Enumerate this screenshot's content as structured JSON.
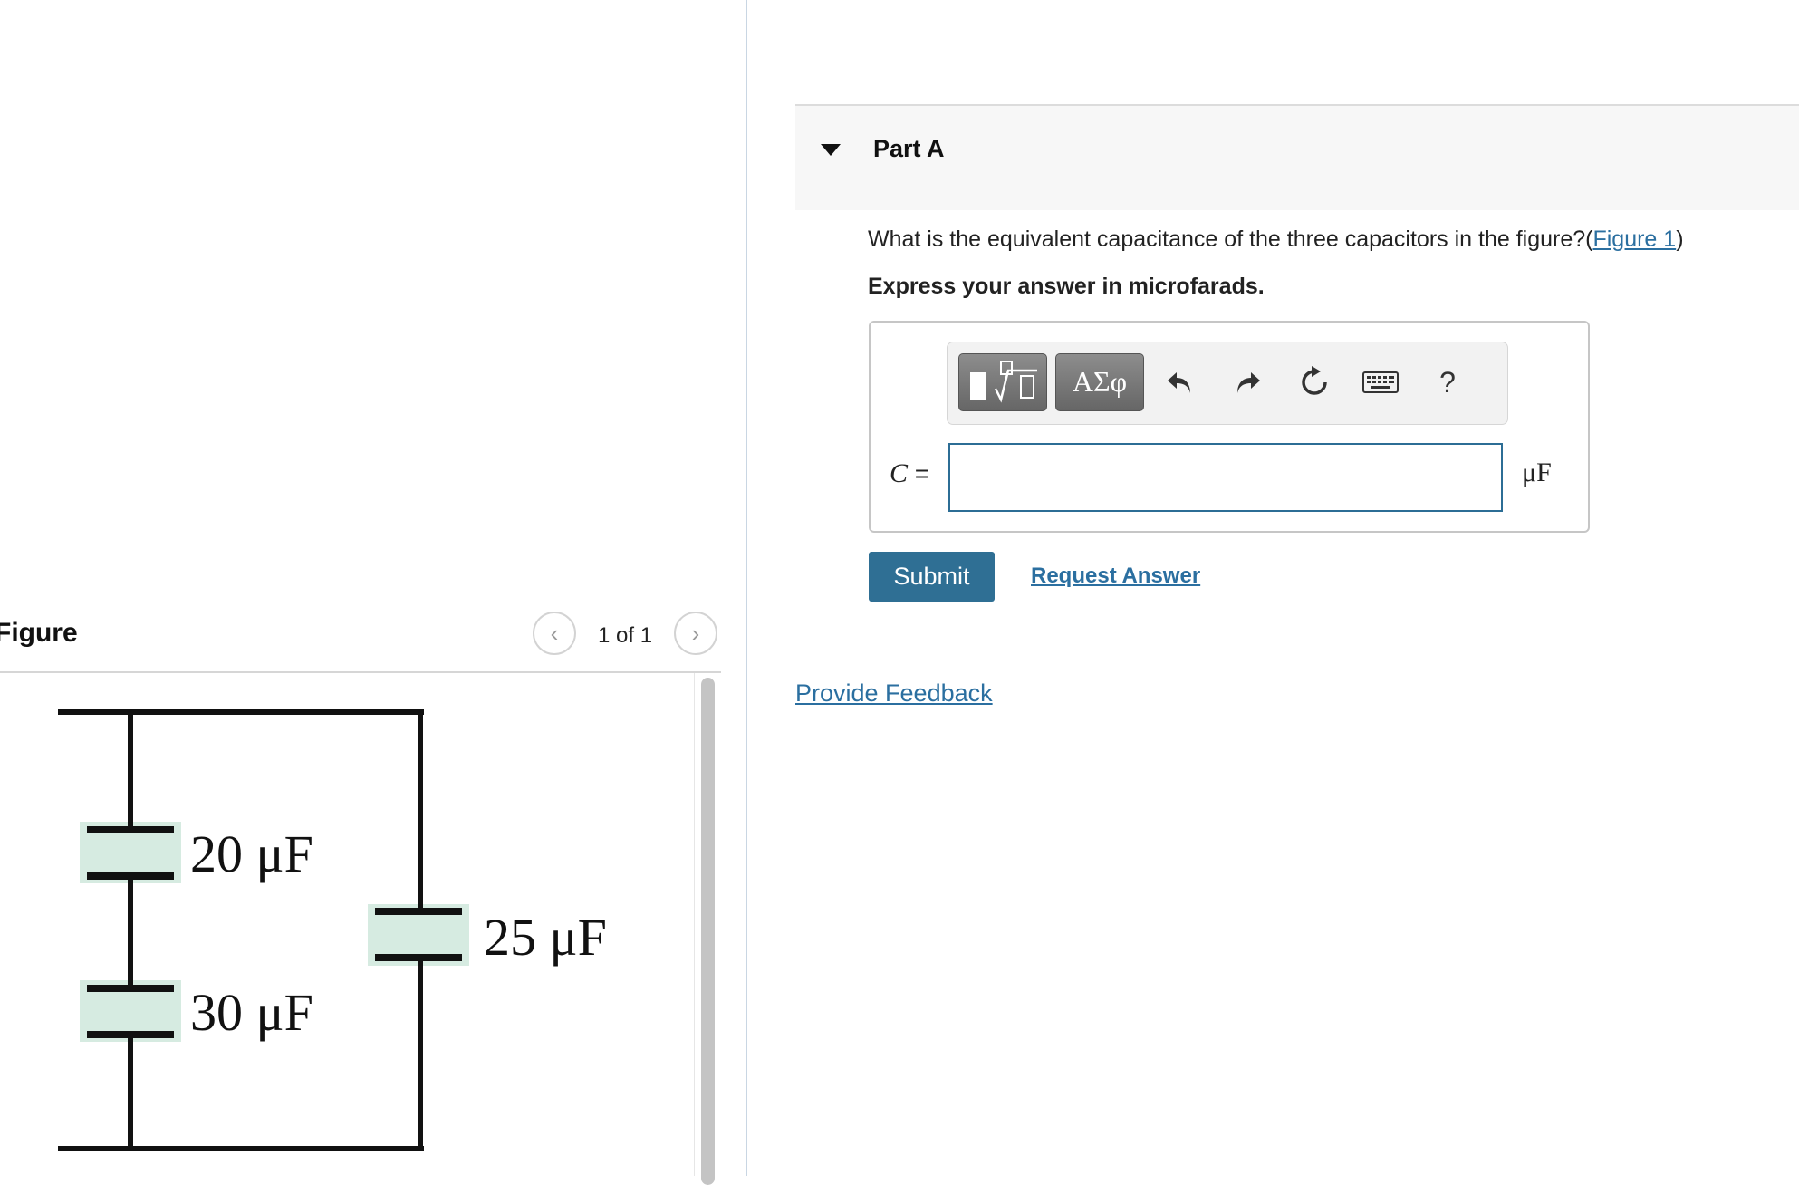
{
  "figure_panel": {
    "title": "Figure",
    "pager": "1 of 1",
    "prev_icon": "chevron-left-icon",
    "next_icon": "chevron-right-icon"
  },
  "circuit": {
    "capacitor_top_left": "20 μF",
    "capacitor_bottom_left": "30 μF",
    "capacitor_right": "25 μF",
    "wire_color": "#111111",
    "highlight_color": "#d6ebe1"
  },
  "part": {
    "title": "Part A",
    "toggle_icon": "caret-down-icon"
  },
  "question": {
    "text": "What is the equivalent capacitance of the three capacitors in the figure?",
    "open_paren": "(",
    "figure_link": "Figure 1",
    "close_paren": ")",
    "instruction": "Express your answer in microfarads."
  },
  "toolbar": {
    "symbols_label": "ΑΣφ",
    "help_label": "?",
    "icons": [
      "templates-icon",
      "undo-icon",
      "redo-icon",
      "reset-icon",
      "keyboard-icon"
    ]
  },
  "answer": {
    "variable": "C",
    "equals": "=",
    "value": "",
    "unit": "μF"
  },
  "actions": {
    "submit_label": "Submit",
    "request_answer_label": "Request Answer",
    "feedback_label": "Provide Feedback"
  },
  "colors": {
    "accent": "#2f6f94",
    "link": "#2b6fa0"
  }
}
